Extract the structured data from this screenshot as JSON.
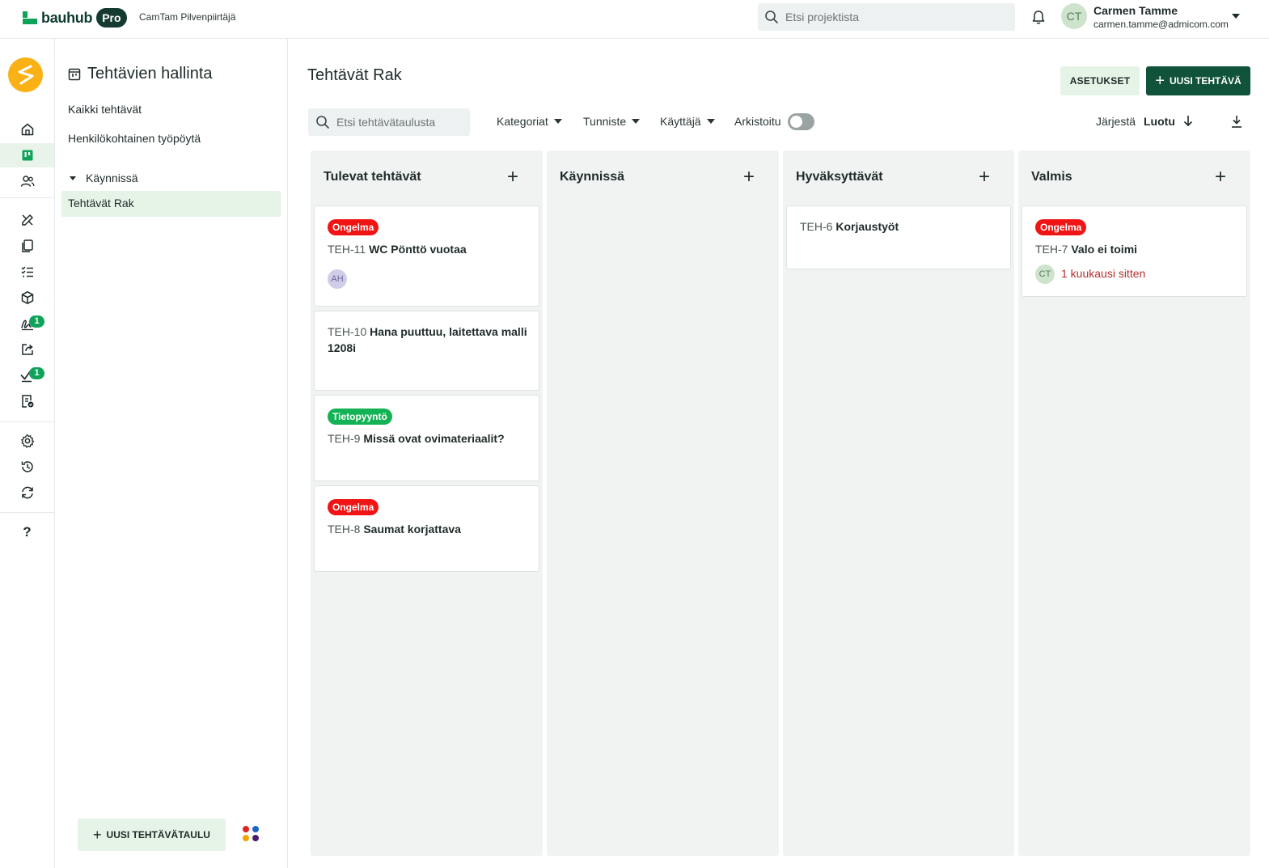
{
  "topbar": {
    "brand": "bauhub",
    "tier": "Pro",
    "project": "CamTam Pilvenpiirtäjä",
    "search_placeholder": "Etsi projektista",
    "user": {
      "initials": "CT",
      "name": "Carmen Tamme",
      "email": "carmen.tamme@admicom.com"
    }
  },
  "rail": {
    "items": [
      "home-icon",
      "board-icon",
      "users-icon",
      "drawing-tools-icon",
      "documents-icon",
      "checklist-icon",
      "box-icon",
      "signature-icon",
      "share-icon",
      "approval-icon",
      "report-icon",
      "settings-icon",
      "history-icon",
      "sync-icon",
      "help-icon"
    ],
    "badges": {
      "signatures": "1",
      "approvals": "1"
    },
    "help": "?"
  },
  "sidebar": {
    "title": "Tehtävien hallinta",
    "links": [
      "Kaikki tehtävät",
      "Henkilökohtainen työpöytä"
    ],
    "group": "Käynnissä",
    "active_board": "Tehtävät Rak",
    "new_board_label": "UUSI TEHTÄVÄTAULU"
  },
  "main": {
    "title": "Tehtävät Rak",
    "settings_label": "ASETUKSET",
    "new_task_label": "UUSI TEHTÄVÄ",
    "board_search_placeholder": "Etsi tehtävätaulusta",
    "filters": {
      "categories": "Kategoriat",
      "tag": "Tunniste",
      "user": "Käyttäjä",
      "archived": "Arkistoitu"
    },
    "archived_toggle": false,
    "sort_label": "Järjestä",
    "sort_value": "Luotu"
  },
  "columns": [
    {
      "title": "Tulevat tehtävät",
      "cards": [
        {
          "badge": "Ongelma",
          "badge_type": "issue",
          "id": "TEH-11",
          "title": "WC Pönttö vuotaa",
          "assignee": "AH"
        },
        {
          "id": "TEH-10",
          "title": "Hana puuttuu, laitettava malli 1208i"
        },
        {
          "badge": "Tietopyyntö",
          "badge_type": "info",
          "id": "TEH-9",
          "title": "Missä ovat ovimateriaalit?"
        },
        {
          "badge": "Ongelma",
          "badge_type": "issue",
          "id": "TEH-8",
          "title": "Saumat korjattava"
        }
      ]
    },
    {
      "title": "Käynnissä",
      "cards": []
    },
    {
      "title": "Hyväksyttävät",
      "cards": [
        {
          "id": "TEH-6",
          "title": "Korjaustyöt"
        }
      ]
    },
    {
      "title": "Valmis",
      "cards": [
        {
          "badge": "Ongelma",
          "badge_type": "issue",
          "id": "TEH-7",
          "title": "Valo ei toimi",
          "assignee": "CT",
          "due": "1 kuukausi sitten"
        }
      ]
    }
  ],
  "colors": {
    "brand_green": "#0fa35a",
    "primary_button": "#11523a",
    "issue_red": "#f01414",
    "info_green": "#13b255",
    "overdue_text": "#b42f2f",
    "column_bg": "#f1f3f3"
  }
}
